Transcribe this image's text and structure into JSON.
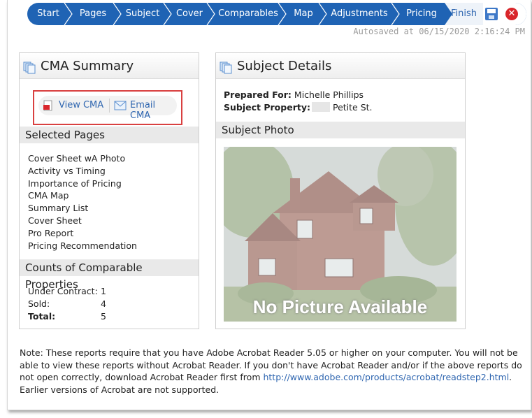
{
  "wizard": {
    "steps": [
      "Start",
      "Pages",
      "Subject",
      "Cover",
      "Comparables",
      "Map",
      "Adjustments",
      "Pricing"
    ],
    "finish_label": "Finish",
    "save_icon": "save-icon",
    "close_icon": "close-icon"
  },
  "autosave_text": "Autosaved at 06/15/2020 2:16:24 PM",
  "cma_summary": {
    "title": "CMA Summary",
    "view_label": "View CMA",
    "email_label": "Email CMA",
    "selected_pages_heading": "Selected Pages",
    "selected_pages": [
      "Cover Sheet wA Photo",
      "Activity vs Timing",
      "Importance of Pricing",
      "CMA Map",
      "Summary List",
      "Cover Sheet",
      "Pro Report",
      "Pricing Recommendation"
    ],
    "counts_heading": "Counts of Comparable Properties",
    "counts": [
      {
        "label": "Under Contract:",
        "value": "1"
      },
      {
        "label": "Sold:",
        "value": "4"
      },
      {
        "label": "Total:",
        "value": "5"
      }
    ]
  },
  "subject_details": {
    "title": "Subject Details",
    "prepared_for_label": "Prepared For",
    "prepared_for_value": "Michelle Phillips",
    "subject_property_label": "Subject Property",
    "subject_property_value": "Petite St.",
    "photo_heading": "Subject Photo",
    "photo_overlay": "No Picture Available"
  },
  "note": {
    "text_before": "Note: These reports require that you have Adobe Acrobat Reader 5.05 or higher on your computer. You will not be able to view these reports without Acrobat Reader. If you don't have Acrobat Reader and/or if the above reports do not open correctly, download Acrobat Reader first from ",
    "link": "http://www.adobe.com/products/acrobat/readstep2.html",
    "text_after": ". Earlier versions of Acrobat are not supported."
  },
  "colors": {
    "wizard_blue": "#1f63b4",
    "link_blue": "#2f66b0",
    "highlight_red": "#d94040"
  }
}
